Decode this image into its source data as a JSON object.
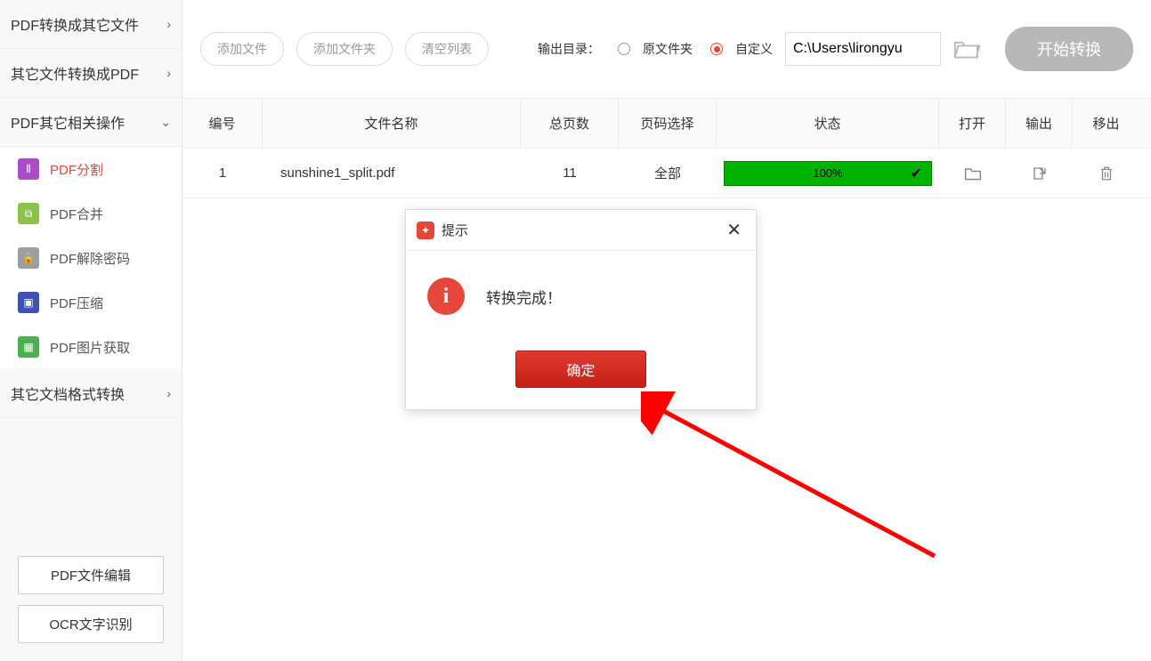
{
  "sidebar": {
    "groups": [
      {
        "label": "PDF转换成其它文件",
        "chev": "›"
      },
      {
        "label": "其它文件转换成PDF",
        "chev": "›"
      },
      {
        "label": "PDF其它相关操作",
        "chev": "⌄"
      },
      {
        "label": "其它文档格式转换",
        "chev": "›"
      }
    ],
    "items": [
      {
        "label": "PDF分割"
      },
      {
        "label": "PDF合并"
      },
      {
        "label": "PDF解除密码"
      },
      {
        "label": "PDF压缩"
      },
      {
        "label": "PDF图片获取"
      }
    ],
    "bottom": [
      {
        "label": "PDF文件编辑"
      },
      {
        "label": "OCR文字识别"
      }
    ]
  },
  "toolbar": {
    "add_file": "添加文件",
    "add_folder": "添加文件夹",
    "clear": "清空列表",
    "output_label": "输出目录：",
    "radio_original": "原文件夹",
    "radio_custom": "自定义",
    "path": "C:\\Users\\lirongyu",
    "start": "开始转换"
  },
  "table": {
    "headers": {
      "num": "编号",
      "name": "文件名称",
      "pages": "总页数",
      "page_sel": "页码选择",
      "status": "状态",
      "open": "打开",
      "output": "输出",
      "remove": "移出"
    },
    "rows": [
      {
        "num": "1",
        "name": "sunshine1_split.pdf",
        "pages": "11",
        "page_sel": "全部",
        "progress": "100%"
      }
    ]
  },
  "dialog": {
    "title": "提示",
    "message": "转换完成！",
    "ok": "确定"
  }
}
